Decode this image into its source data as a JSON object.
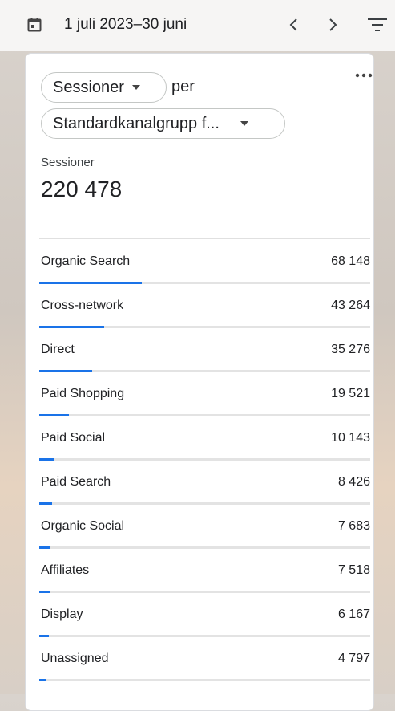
{
  "header": {
    "date_range": "1 juli 2023–30 juni"
  },
  "card": {
    "metric_chip": "Sessioner",
    "per_text": "per",
    "dimension_chip": "Standardkanalgrupp f...",
    "metric_label": "Sessioner",
    "metric_total": "220 478",
    "rows": [
      {
        "name": "Organic Search",
        "value": "68 148",
        "fraction": 0.31
      },
      {
        "name": "Cross-network",
        "value": "43 264",
        "fraction": 0.196
      },
      {
        "name": "Direct",
        "value": "35 276",
        "fraction": 0.16
      },
      {
        "name": "Paid Shopping",
        "value": "19 521",
        "fraction": 0.089
      },
      {
        "name": "Paid Social",
        "value": "10 143",
        "fraction": 0.046
      },
      {
        "name": "Paid Search",
        "value": "8 426",
        "fraction": 0.038
      },
      {
        "name": "Organic Social",
        "value": "7 683",
        "fraction": 0.035
      },
      {
        "name": "Affiliates",
        "value": "7 518",
        "fraction": 0.034
      },
      {
        "name": "Display",
        "value": "6 167",
        "fraction": 0.028
      },
      {
        "name": "Unassigned",
        "value": "4 797",
        "fraction": 0.022
      }
    ]
  },
  "colors": {
    "accent": "#1a73e8",
    "track": "#e3e3e3"
  },
  "icons": [
    "calendar-icon",
    "chevron-left-icon",
    "chevron-right-icon",
    "filter-icon",
    "more-horiz-icon",
    "dropdown-caret-icon"
  ]
}
